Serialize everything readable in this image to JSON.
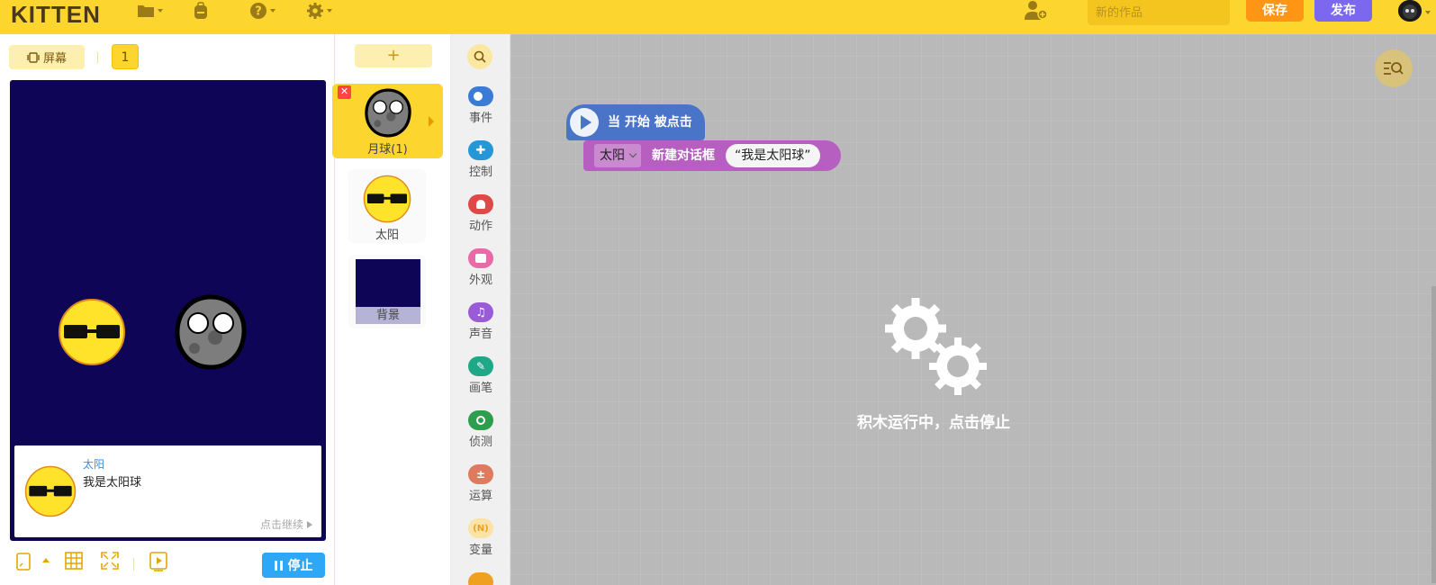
{
  "app": {
    "logo": "KITTEN",
    "project_name_placeholder": "新的作品",
    "save_label": "保存",
    "publish_label": "发布"
  },
  "stage_panel": {
    "screen_label": "屏幕",
    "page_number": "1",
    "dialog": {
      "speaker": "太阳",
      "text": "我是太阳球",
      "continue_label": "点击继续"
    },
    "stop_label": "停止"
  },
  "sprites": {
    "add_label": "+",
    "items": [
      {
        "name": "月球(1)",
        "selected": true
      },
      {
        "name": "太阳",
        "selected": false
      }
    ],
    "background_label": "背景"
  },
  "categories": [
    {
      "label": "事件",
      "color": "#3a7bd5",
      "icon": "event-icon"
    },
    {
      "label": "控制",
      "color": "#2596d6",
      "icon": "control-icon"
    },
    {
      "label": "动作",
      "color": "#e04848",
      "icon": "motion-icon"
    },
    {
      "label": "外观",
      "color": "#e86aa6",
      "icon": "looks-icon"
    },
    {
      "label": "声音",
      "color": "#9a5bd6",
      "icon": "sound-icon"
    },
    {
      "label": "画笔",
      "color": "#1fa887",
      "icon": "pen-icon"
    },
    {
      "label": "侦测",
      "color": "#2e9e4e",
      "icon": "sensing-icon"
    },
    {
      "label": "运算",
      "color": "#e07a5f",
      "icon": "operators-icon"
    },
    {
      "label": "变量",
      "color": "#f0a020",
      "icon": "variables-icon"
    }
  ],
  "workspace": {
    "hat_block_label": "当 开始 被点击",
    "command_block": {
      "target": "太阳",
      "action": "新建对话框",
      "value": "“我是太阳球”"
    },
    "running_message": "积木运行中，点击停止"
  },
  "colors": {
    "topbar": "#fdd52f",
    "stage_bg": "#0f0557",
    "stop_button": "#2ea7f7"
  }
}
